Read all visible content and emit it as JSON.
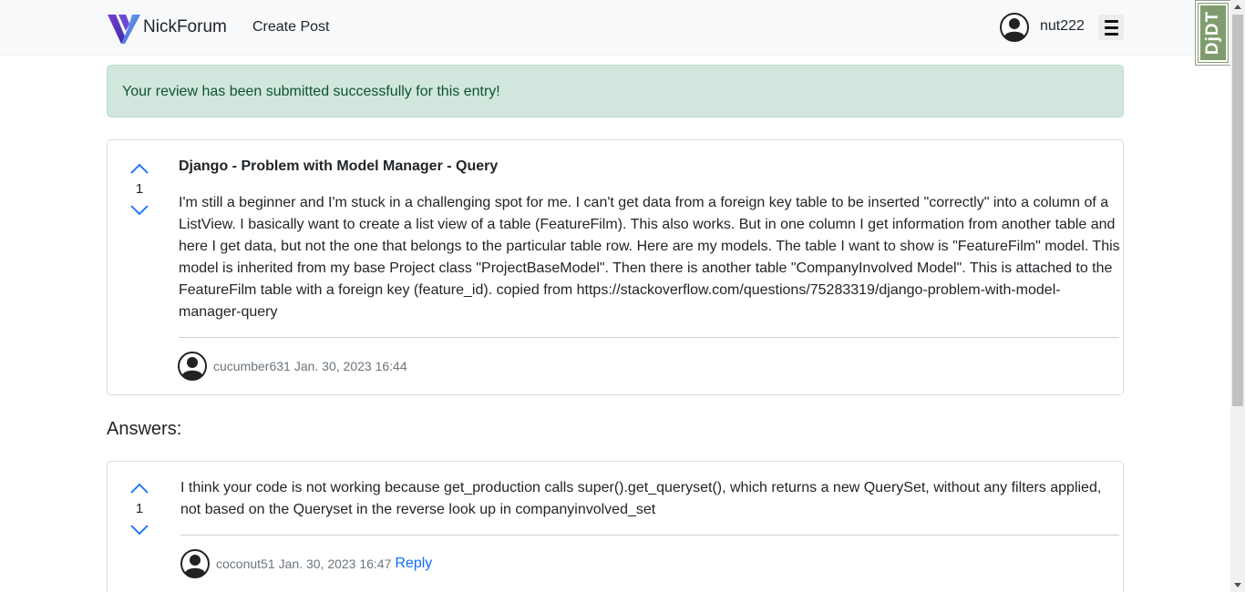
{
  "navbar": {
    "brand_name": "NickForum",
    "create_post_label": "Create Post",
    "username": "nut222",
    "brand_colors": [
      "#4f4bd8",
      "#3b8ae0",
      "#7a3fd0"
    ]
  },
  "debug_toolbar": {
    "label": "DjDT"
  },
  "alert": {
    "message": "Your review has been submitted successfully for this entry!"
  },
  "question": {
    "votes": "1",
    "title": "Django - Problem with Model Manager - Query",
    "body": "I'm still a beginner and I'm stuck in a challenging spot for me. I can't get data from a foreign key table to be inserted \"correctly\" into a column of a ListView. I basically want to create a list view of a table (FeatureFilm). This also works. But in one column I get information from another table and here I get data, but not the one that belongs to the particular table row. Here are my models. The table I want to show is \"FeatureFilm\" model. This model is inherited from my base Project class \"ProjectBaseModel\". Then there is another table \"CompanyInvolved Model\". This is attached to the FeatureFilm table with a foreign key (feature_id). copied from https://stackoverflow.com/questions/75283319/django-problem-with-model-manager-query",
    "author": "cucumber631",
    "date": "Jan. 30, 2023 16:44"
  },
  "answers_heading": "Answers:",
  "answers": [
    {
      "votes": "1",
      "body": "I think your code is not working because get_production calls super().get_queryset(), which returns a new QuerySet, without any filters applied, not based on the Queryset in the reverse look up in companyinvolved_set",
      "author": "coconut51",
      "date": "Jan. 30, 2023 16:47",
      "reply_label": "Reply"
    }
  ],
  "icons": {
    "upvote": "chevron-up-icon",
    "downvote": "chevron-down-icon",
    "avatar": "user-avatar-icon",
    "menu": "hamburger-menu-icon"
  },
  "colors": {
    "accent": "#0d6efd",
    "alert_bg": "#d1e7dd",
    "alert_text": "#0f5132",
    "debug_green": "#7f9c6e"
  }
}
